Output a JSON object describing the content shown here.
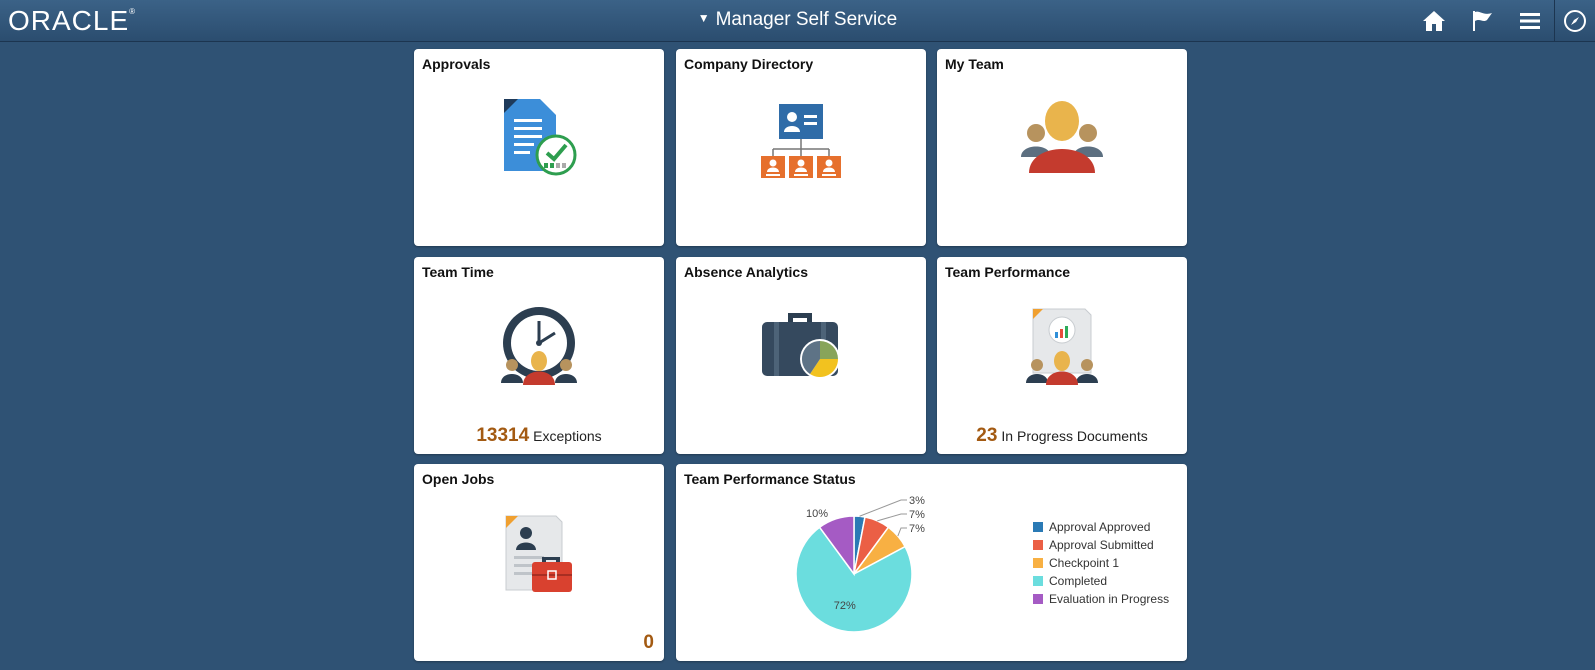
{
  "header": {
    "logo": "ORACLE",
    "logo_mark": "®",
    "title": "Manager Self Service",
    "caret": "▼",
    "icons": [
      "home-icon",
      "flag-icon",
      "menu-icon",
      "navigator-icon"
    ]
  },
  "tiles": {
    "approvals": {
      "title": "Approvals"
    },
    "company_directory": {
      "title": "Company Directory"
    },
    "my_team": {
      "title": "My Team"
    },
    "team_time": {
      "title": "Team Time",
      "count": "13314",
      "count_label": "Exceptions"
    },
    "absence_analytics": {
      "title": "Absence Analytics"
    },
    "team_performance": {
      "title": "Team Performance",
      "count": "23",
      "count_label": "In Progress Documents"
    },
    "open_jobs": {
      "title": "Open Jobs",
      "count": "0"
    },
    "team_performance_status": {
      "title": "Team Performance Status"
    }
  },
  "colors": {
    "banner": "#2f5274",
    "accent_count": "#a35a12"
  },
  "chart_data": {
    "type": "pie",
    "categories": [
      "Approval Approved",
      "Approval Submitted",
      "Checkpoint 1",
      "Completed",
      "Evaluation in Progress"
    ],
    "values": [
      3,
      7,
      7,
      72,
      10
    ],
    "labels": [
      "3%",
      "7%",
      "7%",
      "72%",
      "10%"
    ],
    "colors": [
      "#2a7ab5",
      "#eb5f45",
      "#f8b043",
      "#6bddde",
      "#a55bc4"
    ],
    "legend": "right"
  }
}
